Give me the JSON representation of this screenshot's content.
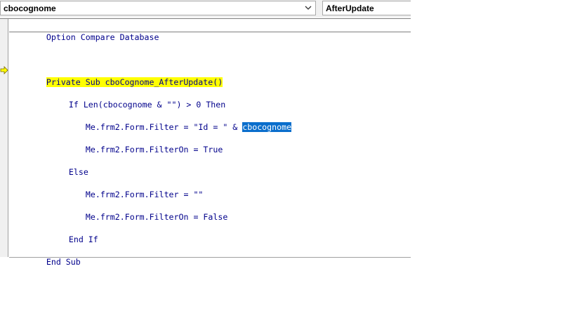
{
  "toolbar": {
    "object_combo": "cbocognome",
    "procedure_combo": "AfterUpdate"
  },
  "code": {
    "line_option": "Option Compare Database",
    "sub_header": "Private Sub cboCognome_AfterUpdate()",
    "if_line": "If Len(cbocognome & \"\") > 0 Then",
    "filter_line_pre": "Me.frm2.Form.Filter = \"Id = \" & ",
    "filter_line_sel": "cbocognome",
    "filteron_true": "Me.frm2.Form.FilterOn = True",
    "else_line": "Else",
    "filter_empty": "Me.frm2.Form.Filter = \"\"",
    "filteron_false": "Me.frm2.Form.FilterOn = False",
    "end_if": "End If",
    "end_sub": "End Sub"
  },
  "colors": {
    "current_statement_highlight": "#ffff00",
    "selection": "#0a6ecc",
    "code_text": "#00008b"
  },
  "icons": {
    "execution_pointer": "arrow-right-icon",
    "dropdown": "chevron-down-icon"
  }
}
